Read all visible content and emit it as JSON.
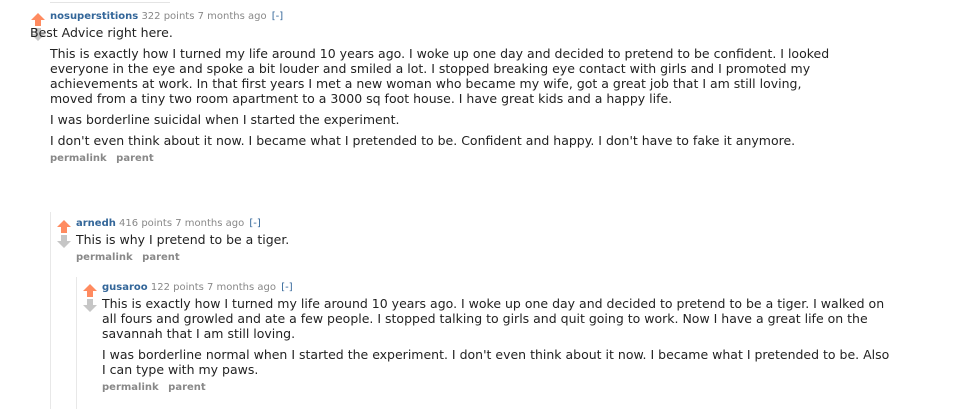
{
  "colors": {
    "upvote": "#ff8b60",
    "downvote": "#c6c6c6",
    "author": "#336699",
    "meta": "#888888",
    "text": "#222222"
  },
  "comments": [
    {
      "author": "nosuperstitions",
      "score": "322 points",
      "time": "7 months ago",
      "expand": "[-]",
      "paragraphs": [
        "Best Advice right here.",
        "This is exactly how I turned my life around 10 years ago. I woke up one day and decided to pretend to be confident. I looked everyone in the eye and spoke a bit louder and smiled a lot. I stopped breaking eye contact with girls and I promoted my achievements at work. In that first years I met a new woman who became my wife, got a great job that I am still loving, moved from a tiny two room apartment to a 3000 sq foot house. I have great kids and a happy life.",
        "I was borderline suicidal when I started the experiment.",
        "I don't even think about it now. I became what I pretended to be. Confident and happy. I don't have to fake it anymore."
      ],
      "buttons": [
        "permalink",
        "parent"
      ]
    },
    {
      "author": "arnedh",
      "score": "416 points",
      "time": "7 months ago",
      "expand": "[-]",
      "paragraphs": [
        "This is why I pretend to be a tiger."
      ],
      "buttons": [
        "permalink",
        "parent"
      ]
    },
    {
      "author": "gusaroo",
      "score": "122 points",
      "time": "7 months ago",
      "expand": "[-]",
      "paragraphs": [
        "This is exactly how I turned my life around 10 years ago. I woke up one day and decided to pretend to be a tiger. I walked on all fours and growled and ate a few people. I stopped talking to girls and quit going to work. Now I have a great life on the savannah that I am still loving.",
        "I was borderline normal when I started the experiment. I don't even think about it now. I became what I pretended to be. Also I can type with my paws."
      ],
      "buttons": [
        "permalink",
        "parent"
      ]
    }
  ]
}
